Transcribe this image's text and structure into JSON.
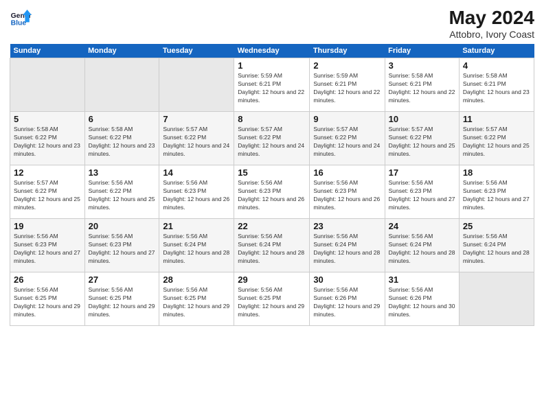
{
  "header": {
    "logo_line1": "General",
    "logo_line2": "Blue",
    "title": "May 2024",
    "subtitle": "Attobro, Ivory Coast"
  },
  "weekdays": [
    "Sunday",
    "Monday",
    "Tuesday",
    "Wednesday",
    "Thursday",
    "Friday",
    "Saturday"
  ],
  "weeks": [
    [
      {
        "day": "",
        "empty": true
      },
      {
        "day": "",
        "empty": true
      },
      {
        "day": "",
        "empty": true
      },
      {
        "day": "1",
        "sunrise": "5:59 AM",
        "sunset": "6:21 PM",
        "daylight": "12 hours and 22 minutes."
      },
      {
        "day": "2",
        "sunrise": "5:59 AM",
        "sunset": "6:21 PM",
        "daylight": "12 hours and 22 minutes."
      },
      {
        "day": "3",
        "sunrise": "5:58 AM",
        "sunset": "6:21 PM",
        "daylight": "12 hours and 22 minutes."
      },
      {
        "day": "4",
        "sunrise": "5:58 AM",
        "sunset": "6:21 PM",
        "daylight": "12 hours and 23 minutes."
      }
    ],
    [
      {
        "day": "5",
        "sunrise": "5:58 AM",
        "sunset": "6:22 PM",
        "daylight": "12 hours and 23 minutes."
      },
      {
        "day": "6",
        "sunrise": "5:58 AM",
        "sunset": "6:22 PM",
        "daylight": "12 hours and 23 minutes."
      },
      {
        "day": "7",
        "sunrise": "5:57 AM",
        "sunset": "6:22 PM",
        "daylight": "12 hours and 24 minutes."
      },
      {
        "day": "8",
        "sunrise": "5:57 AM",
        "sunset": "6:22 PM",
        "daylight": "12 hours and 24 minutes."
      },
      {
        "day": "9",
        "sunrise": "5:57 AM",
        "sunset": "6:22 PM",
        "daylight": "12 hours and 24 minutes."
      },
      {
        "day": "10",
        "sunrise": "5:57 AM",
        "sunset": "6:22 PM",
        "daylight": "12 hours and 25 minutes."
      },
      {
        "day": "11",
        "sunrise": "5:57 AM",
        "sunset": "6:22 PM",
        "daylight": "12 hours and 25 minutes."
      }
    ],
    [
      {
        "day": "12",
        "sunrise": "5:57 AM",
        "sunset": "6:22 PM",
        "daylight": "12 hours and 25 minutes."
      },
      {
        "day": "13",
        "sunrise": "5:56 AM",
        "sunset": "6:22 PM",
        "daylight": "12 hours and 25 minutes."
      },
      {
        "day": "14",
        "sunrise": "5:56 AM",
        "sunset": "6:23 PM",
        "daylight": "12 hours and 26 minutes."
      },
      {
        "day": "15",
        "sunrise": "5:56 AM",
        "sunset": "6:23 PM",
        "daylight": "12 hours and 26 minutes."
      },
      {
        "day": "16",
        "sunrise": "5:56 AM",
        "sunset": "6:23 PM",
        "daylight": "12 hours and 26 minutes."
      },
      {
        "day": "17",
        "sunrise": "5:56 AM",
        "sunset": "6:23 PM",
        "daylight": "12 hours and 27 minutes."
      },
      {
        "day": "18",
        "sunrise": "5:56 AM",
        "sunset": "6:23 PM",
        "daylight": "12 hours and 27 minutes."
      }
    ],
    [
      {
        "day": "19",
        "sunrise": "5:56 AM",
        "sunset": "6:23 PM",
        "daylight": "12 hours and 27 minutes."
      },
      {
        "day": "20",
        "sunrise": "5:56 AM",
        "sunset": "6:23 PM",
        "daylight": "12 hours and 27 minutes."
      },
      {
        "day": "21",
        "sunrise": "5:56 AM",
        "sunset": "6:24 PM",
        "daylight": "12 hours and 28 minutes."
      },
      {
        "day": "22",
        "sunrise": "5:56 AM",
        "sunset": "6:24 PM",
        "daylight": "12 hours and 28 minutes."
      },
      {
        "day": "23",
        "sunrise": "5:56 AM",
        "sunset": "6:24 PM",
        "daylight": "12 hours and 28 minutes."
      },
      {
        "day": "24",
        "sunrise": "5:56 AM",
        "sunset": "6:24 PM",
        "daylight": "12 hours and 28 minutes."
      },
      {
        "day": "25",
        "sunrise": "5:56 AM",
        "sunset": "6:24 PM",
        "daylight": "12 hours and 28 minutes."
      }
    ],
    [
      {
        "day": "26",
        "sunrise": "5:56 AM",
        "sunset": "6:25 PM",
        "daylight": "12 hours and 29 minutes."
      },
      {
        "day": "27",
        "sunrise": "5:56 AM",
        "sunset": "6:25 PM",
        "daylight": "12 hours and 29 minutes."
      },
      {
        "day": "28",
        "sunrise": "5:56 AM",
        "sunset": "6:25 PM",
        "daylight": "12 hours and 29 minutes."
      },
      {
        "day": "29",
        "sunrise": "5:56 AM",
        "sunset": "6:25 PM",
        "daylight": "12 hours and 29 minutes."
      },
      {
        "day": "30",
        "sunrise": "5:56 AM",
        "sunset": "6:26 PM",
        "daylight": "12 hours and 29 minutes."
      },
      {
        "day": "31",
        "sunrise": "5:56 AM",
        "sunset": "6:26 PM",
        "daylight": "12 hours and 30 minutes."
      },
      {
        "day": "",
        "empty": true
      }
    ]
  ]
}
